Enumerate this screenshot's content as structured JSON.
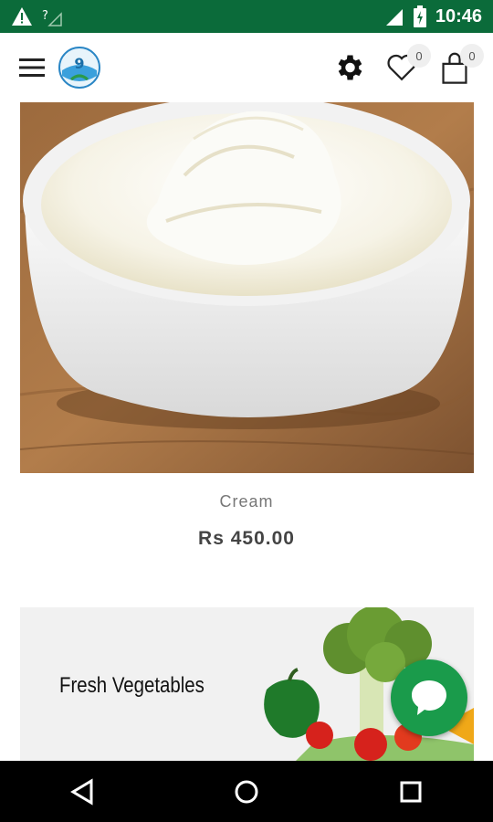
{
  "status_bar": {
    "time": "10:46",
    "icons": [
      "warning-icon",
      "no-signal-icon",
      "signal-icon",
      "battery-icon"
    ],
    "background": "#0b6b3a"
  },
  "header": {
    "menu_icon": "hamburger-menu-icon",
    "logo": "brand-logo",
    "settings_icon": "gear-icon",
    "wishlist_icon": "heart-icon",
    "wishlist_count": "0",
    "cart_icon": "shopping-bag-icon",
    "cart_count": "0"
  },
  "product": {
    "name": "Cream",
    "price": "Rs 450.00",
    "image": "bowl-of-cream"
  },
  "banner": {
    "title": "Fresh Vegetables",
    "image": "vegetables"
  },
  "chat": {
    "icon": "chat-bubble-icon",
    "color": "#1a9b4b"
  },
  "nav_bar": {
    "buttons": [
      "back-icon",
      "home-icon",
      "recents-icon"
    ]
  }
}
